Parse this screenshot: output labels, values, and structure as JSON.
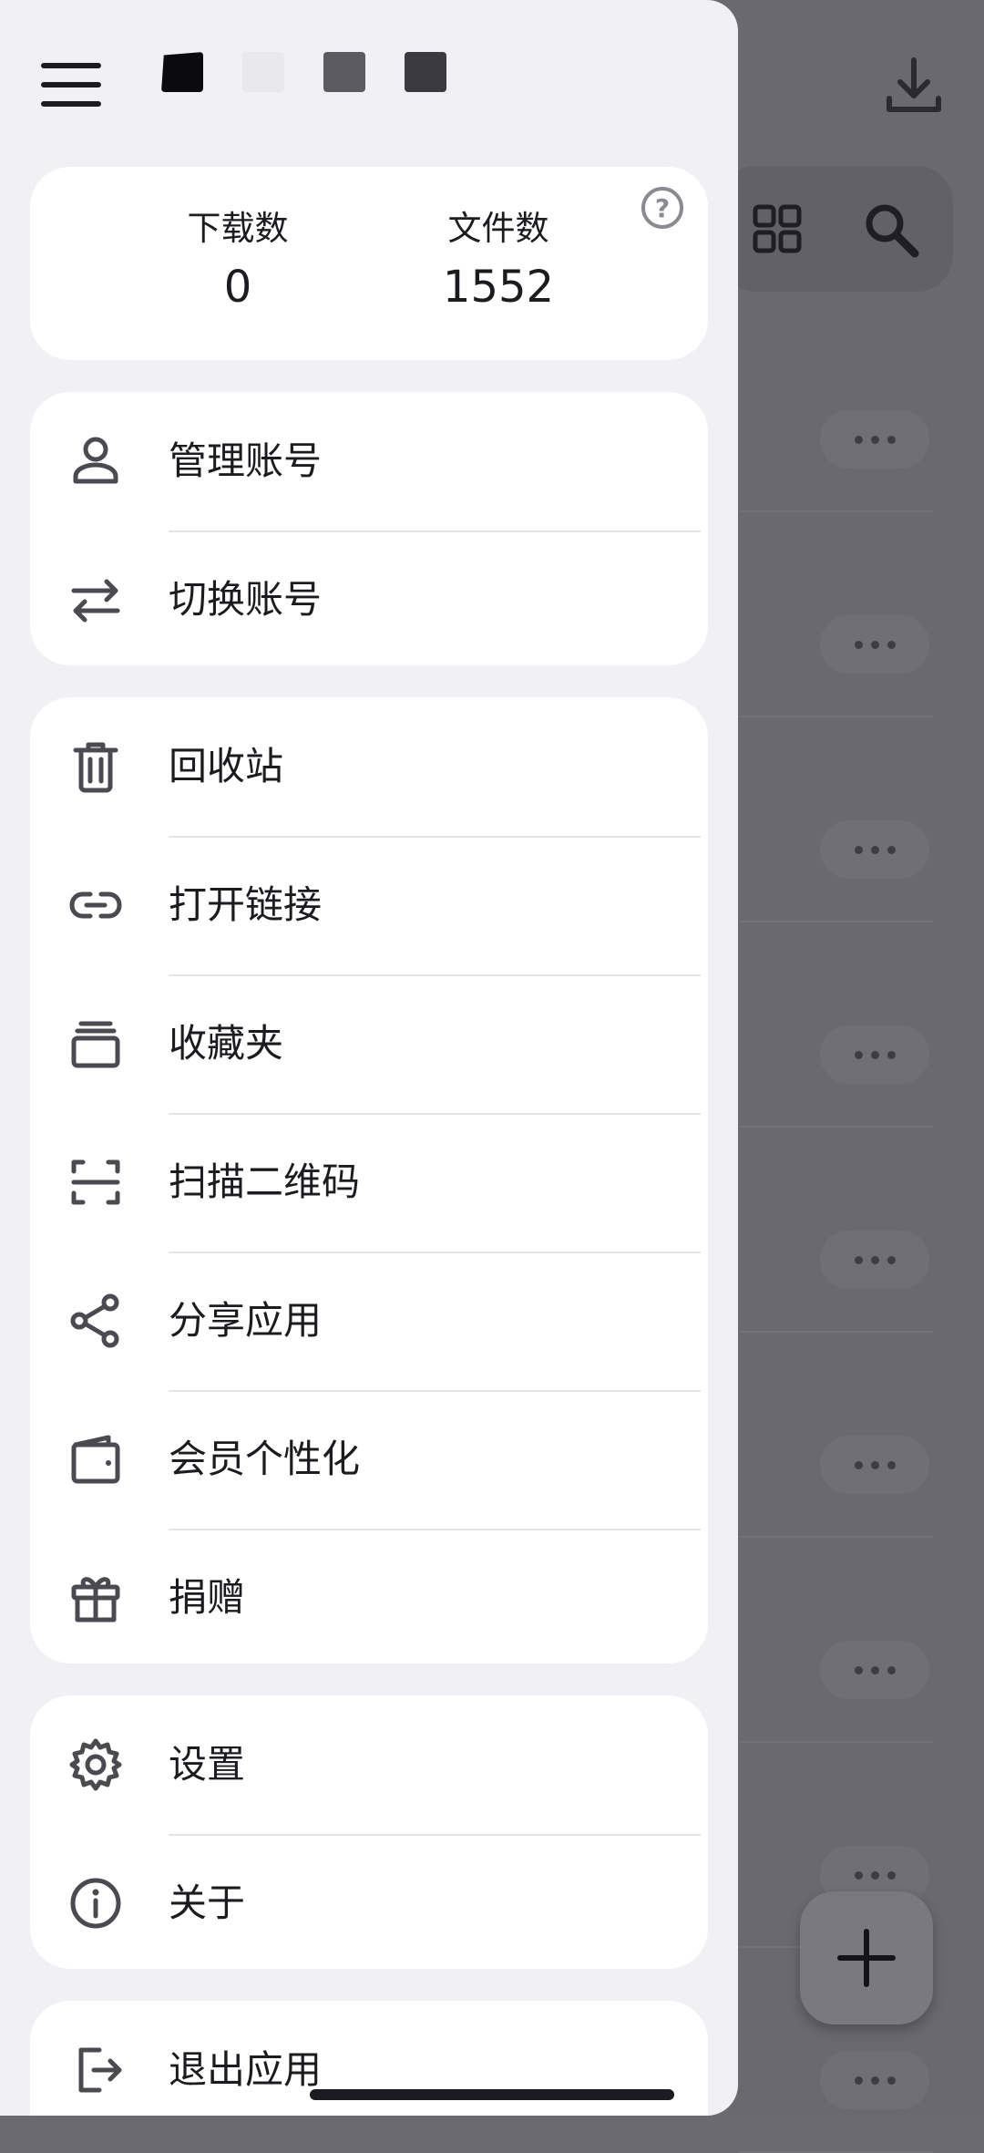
{
  "stats": {
    "downloads_label": "下载数",
    "downloads_value": "0",
    "files_label": "文件数",
    "files_value": "1552"
  },
  "header": {
    "theme_colors": [
      "#0b0b0d",
      "#e9e8ed",
      "#5c5b61",
      "#3b3a40"
    ],
    "icons": [
      "menu-icon",
      "download-icon",
      "grid-view-icon",
      "search-icon",
      "help-icon"
    ]
  },
  "account_menu": [
    {
      "label": "管理账号",
      "icon": "person-icon"
    },
    {
      "label": "切换账号",
      "icon": "swap-icon"
    }
  ],
  "tools_menu": [
    {
      "label": "回收站",
      "icon": "trash-icon"
    },
    {
      "label": "打开链接",
      "icon": "link-icon"
    },
    {
      "label": "收藏夹",
      "icon": "collections-icon"
    },
    {
      "label": "扫描二维码",
      "icon": "qr-scan-icon"
    },
    {
      "label": "分享应用",
      "icon": "share-icon"
    },
    {
      "label": "会员个性化",
      "icon": "wallet-icon"
    },
    {
      "label": "捐赠",
      "icon": "gift-icon"
    }
  ],
  "settings_menu": [
    {
      "label": "设置",
      "icon": "gear-icon"
    },
    {
      "label": "关于",
      "icon": "info-icon"
    }
  ],
  "exit_menu": [
    {
      "label": "退出应用",
      "icon": "logout-icon"
    }
  ],
  "background": {
    "fab_label": "+",
    "row_more_count": 9
  }
}
